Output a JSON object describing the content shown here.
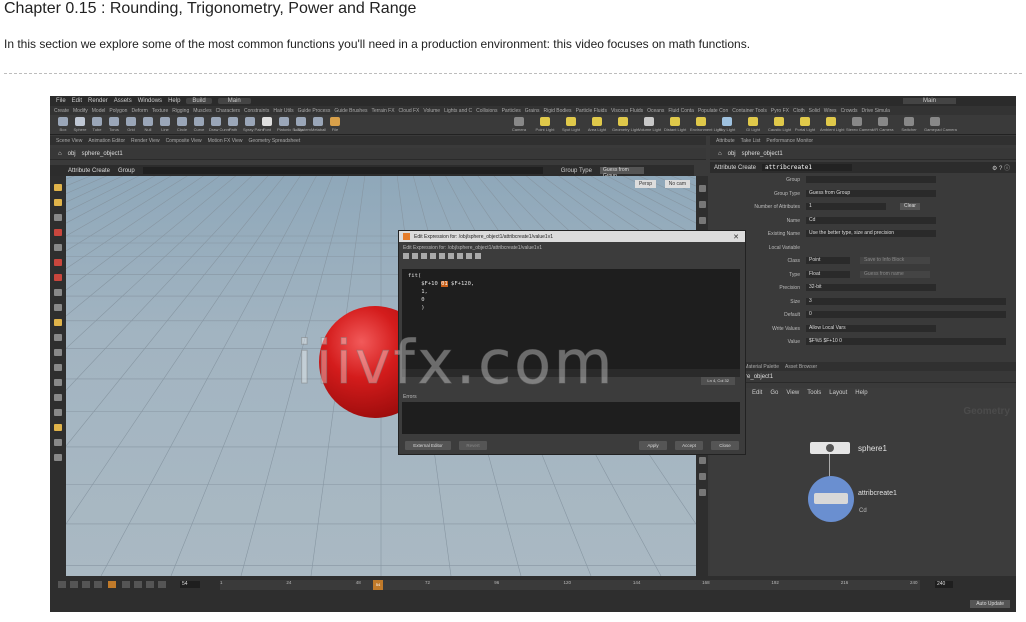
{
  "page": {
    "title": "Chapter 0.15 : Rounding, Trigonometry, Power and Range",
    "intro": "In this section we explore some of the most common functions you'll need in a production environment: this video focuses on math functions."
  },
  "watermark": "iiivfx.com",
  "houdini": {
    "menu": [
      "File",
      "Edit",
      "Render",
      "Assets",
      "Windows",
      "Help"
    ],
    "build_label": "Build",
    "desktop_label": "Main",
    "desktop_label_right": "Main",
    "shelf_tabs": [
      "Create",
      "Modify",
      "Model",
      "Polygon",
      "Deform",
      "Texture",
      "Rigging",
      "Muscles",
      "Characters",
      "Constraints",
      "Hair Utils",
      "Guide Process",
      "Guide Brushes",
      "Terrain FX",
      "Cloud FX",
      "Volume",
      "Lights and C",
      "Collisions",
      "Particles",
      "Grains",
      "Rigid Bodies",
      "Particle Fluids",
      "Viscous Fluids",
      "Oceans",
      "Fluid Conta",
      "Populate Con",
      "Container Tools",
      "Pyro FX",
      "Cloth",
      "Solid",
      "Wires",
      "Crowds",
      "Drive Simula"
    ],
    "left_tools": [
      {
        "label": "Box",
        "color": "#9aa6b8"
      },
      {
        "label": "Sphere",
        "color": "#bfc7d4"
      },
      {
        "label": "Tube",
        "color": "#9aa6b8"
      },
      {
        "label": "Torus",
        "color": "#9aa6b8"
      },
      {
        "label": "Grid",
        "color": "#9aa6b8"
      },
      {
        "label": "Null",
        "color": "#9aa6b8"
      },
      {
        "label": "Line",
        "color": "#9aa6b8"
      },
      {
        "label": "Circle",
        "color": "#9aa6b8"
      },
      {
        "label": "Curve",
        "color": "#9aa6b8"
      },
      {
        "label": "Draw Curve",
        "color": "#9aa6b8"
      },
      {
        "label": "Path",
        "color": "#9aa6b8"
      },
      {
        "label": "Spray Paint",
        "color": "#9aa6b8"
      },
      {
        "label": "Font",
        "color": "#e0e0e0"
      },
      {
        "label": "Platonic Solids",
        "color": "#9aa6b8"
      },
      {
        "label": "L-System",
        "color": "#9aa6b8"
      },
      {
        "label": "Metaball",
        "color": "#9aa6b8"
      },
      {
        "label": "File",
        "color": "#d8a04a"
      }
    ],
    "right_tools": [
      {
        "label": "Camera",
        "color": "#888888"
      },
      {
        "label": "Point Light",
        "color": "#e0c94a"
      },
      {
        "label": "Spot Light",
        "color": "#e0c94a"
      },
      {
        "label": "Area Light",
        "color": "#e0c94a"
      },
      {
        "label": "Geometry Light",
        "color": "#e0c94a"
      },
      {
        "label": "Volume Light",
        "color": "#c8c8c8"
      },
      {
        "label": "Distant Light",
        "color": "#e0c94a"
      },
      {
        "label": "Environment Light",
        "color": "#e0c94a"
      },
      {
        "label": "Sky Light",
        "color": "#9fc2e0"
      },
      {
        "label": "GI Light",
        "color": "#e0c94a"
      },
      {
        "label": "Caustic Light",
        "color": "#e0c94a"
      },
      {
        "label": "Portal Light",
        "color": "#e0c94a"
      },
      {
        "label": "Ambient Light",
        "color": "#e0c94a"
      },
      {
        "label": "Stereo Camera",
        "color": "#888888"
      },
      {
        "label": "VR Camera",
        "color": "#888888"
      },
      {
        "label": "Switcher",
        "color": "#888888"
      },
      {
        "label": "Gamepad Camera",
        "color": "#888888"
      }
    ],
    "pane_tabs_left": [
      "Scene View",
      "Animation Editor",
      "Render View",
      "Composite View",
      "Motion FX View",
      "Geometry Spreadsheet"
    ],
    "pane_tabs_right": [
      "Attribute",
      "Take List",
      "Performance Monitor"
    ],
    "path_obj": "obj",
    "path_node": "sphere_object1",
    "operation": "Attribute Create",
    "group_label": "Group",
    "group_type_label": "Group Type",
    "group_type_value": "Guess from Group",
    "viewport": {
      "persp": "Persp",
      "camera": "No cam"
    },
    "param": {
      "node_type": "Attribute Create",
      "node_name": "attribcreate1",
      "rows": [
        {
          "label": "Group",
          "value": ""
        },
        {
          "label": "Group Type",
          "value": "Guess from Group"
        },
        {
          "label": "Number of Attributes",
          "value": "1",
          "button": "Clear"
        },
        {
          "label": "Name",
          "value": "Cd"
        },
        {
          "label": "Existing Name",
          "value": "Use the better type, size and precision"
        },
        {
          "label": "Local Variable",
          "value": ""
        },
        {
          "label": "Class",
          "value": "Point",
          "extra": "Save to Info Block"
        },
        {
          "label": "Type",
          "value": "Float",
          "extra": "Guess from name"
        },
        {
          "label": "Precision",
          "value": "32-bit"
        },
        {
          "label": "Size",
          "value": "3"
        },
        {
          "label": "Default",
          "value": "0"
        },
        {
          "label": "Write Values",
          "value": "Allow Local Vars"
        },
        {
          "label": "Value",
          "value": "$F%5  $F+10  0"
        }
      ]
    },
    "dialog": {
      "title": "Edit Expression for: /obj/sphere_object1/attribcreate1/value1v1",
      "path": "Edit Expression for: /obj/sphere_object1/attribcreate1/value1v1",
      "code_line1": "fit(",
      "code_line2_a": "    $F+10 ",
      "code_line2_hl": "01",
      "code_line2_b": " $F+120,",
      "code_line3": "    1,",
      "code_line4": "    0",
      "code_line5": "    )",
      "cursor": "Ln 4, Col 32",
      "message_label": "Errors",
      "buttons": {
        "external": "External Editor",
        "revert": "Revert",
        "apply": "Apply",
        "accept": "Accept",
        "close": "Close"
      }
    },
    "network": {
      "tabs": [
        "Tree View",
        "Material Palette",
        "Asset Browser"
      ],
      "path_obj": "obj",
      "path_node": "sphere_object1",
      "menu": [
        "Edit",
        "Go",
        "View",
        "Tools",
        "Layout",
        "Help"
      ],
      "context": "Geometry",
      "node1": "sphere1",
      "node2": "attribcreate1",
      "node2_attr": "Cd"
    },
    "timeline": {
      "ticks": [
        "1",
        "24",
        "48",
        "72",
        "96",
        "120",
        "144",
        "168",
        "192",
        "216",
        "240"
      ],
      "current": "54",
      "frame": "54",
      "end": "240",
      "auto_update": "Auto Update"
    }
  }
}
